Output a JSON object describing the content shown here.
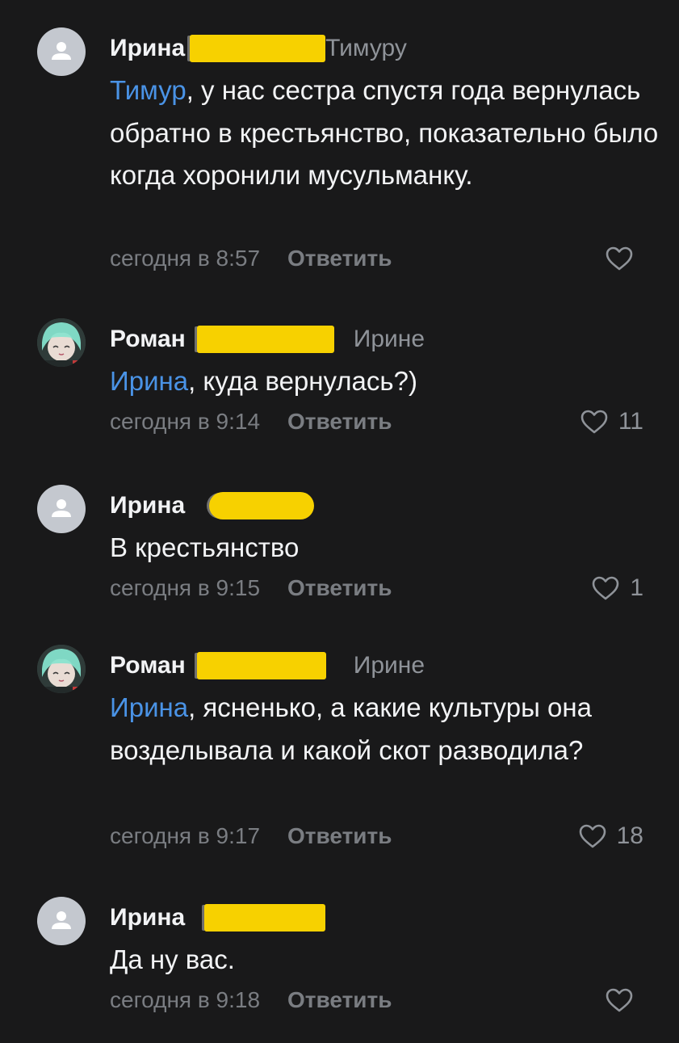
{
  "comments": [
    {
      "author": "Ирина",
      "reply_to": "Тимуру",
      "mention": "Тимур",
      "text": ", у нас сестра спустя года вернулась обратно в крестьянство, показательно было когда хоронили мусульманку.",
      "time": "сегодня в 8:57",
      "reply_label": "Ответить",
      "likes": "",
      "avatar": "default-user-icon"
    },
    {
      "author": "Роман",
      "reply_to": "Ирине",
      "mention": "Ирина",
      "text": ", куда вернулась?)",
      "time": "сегодня в 9:14",
      "reply_label": "Ответить",
      "likes": "11",
      "avatar": "anime-avatar"
    },
    {
      "author": "Ирина",
      "reply_to": "",
      "mention": "",
      "text": "В крестьянство",
      "time": "сегодня в 9:15",
      "reply_label": "Ответить",
      "likes": "1",
      "avatar": "default-user-icon"
    },
    {
      "author": "Роман",
      "reply_to": "Ирине",
      "mention": "Ирина",
      "text": ", ясненько, а какие культуры она возделывала и какой скот разводила?",
      "time": "сегодня в 9:17",
      "reply_label": "Ответить",
      "likes": "18",
      "avatar": "anime-avatar"
    },
    {
      "author": "Ирина",
      "reply_to": "",
      "mention": "",
      "text": "Да ну вас.",
      "time": "сегодня в 9:18",
      "reply_label": "Ответить",
      "likes": "",
      "avatar": "default-user-icon"
    }
  ],
  "colors": {
    "background": "#19191a",
    "mention": "#4a93e6",
    "redaction": "#f7d100",
    "muted": "#7a7d82"
  }
}
